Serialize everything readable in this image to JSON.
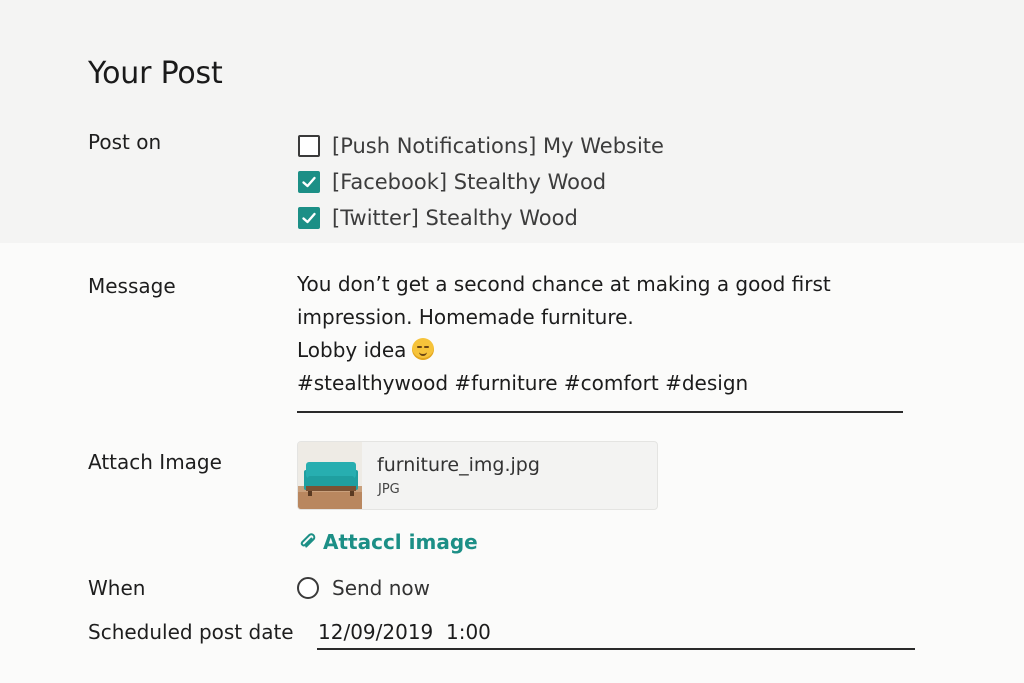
{
  "page": {
    "title": "Your Post"
  },
  "post_on": {
    "label": "Post on",
    "options": [
      {
        "label": "[Push Notifications] My Website",
        "checked": false
      },
      {
        "label": "[Facebook] Stealthy Wood",
        "checked": true
      },
      {
        "label": "[Twitter] Stealthy Wood",
        "checked": true
      }
    ]
  },
  "message": {
    "label": "Message",
    "lines": [
      "You don’t get a second chance at making a good first",
      "impression. Homemade furniture.",
      "Lobby idea",
      "#stealthywood #furniture #comfort #design"
    ],
    "emoji_icon": "smiling-face-emoji"
  },
  "attach_image": {
    "label": "Attach Image",
    "file_name": "furniture_img.jpg",
    "file_type": "JPG",
    "link_label": "Attaccl image",
    "link_icon": "paperclip-icon"
  },
  "when": {
    "label": "When",
    "options": [
      {
        "label": "Send now",
        "selected": false
      }
    ]
  },
  "scheduled": {
    "label": "Scheduled post date",
    "value": "12/09/2019  1:00"
  },
  "colors": {
    "accent": "#1c8f86",
    "top_band": "#f4f4f3",
    "background": "#fbfbfa"
  }
}
